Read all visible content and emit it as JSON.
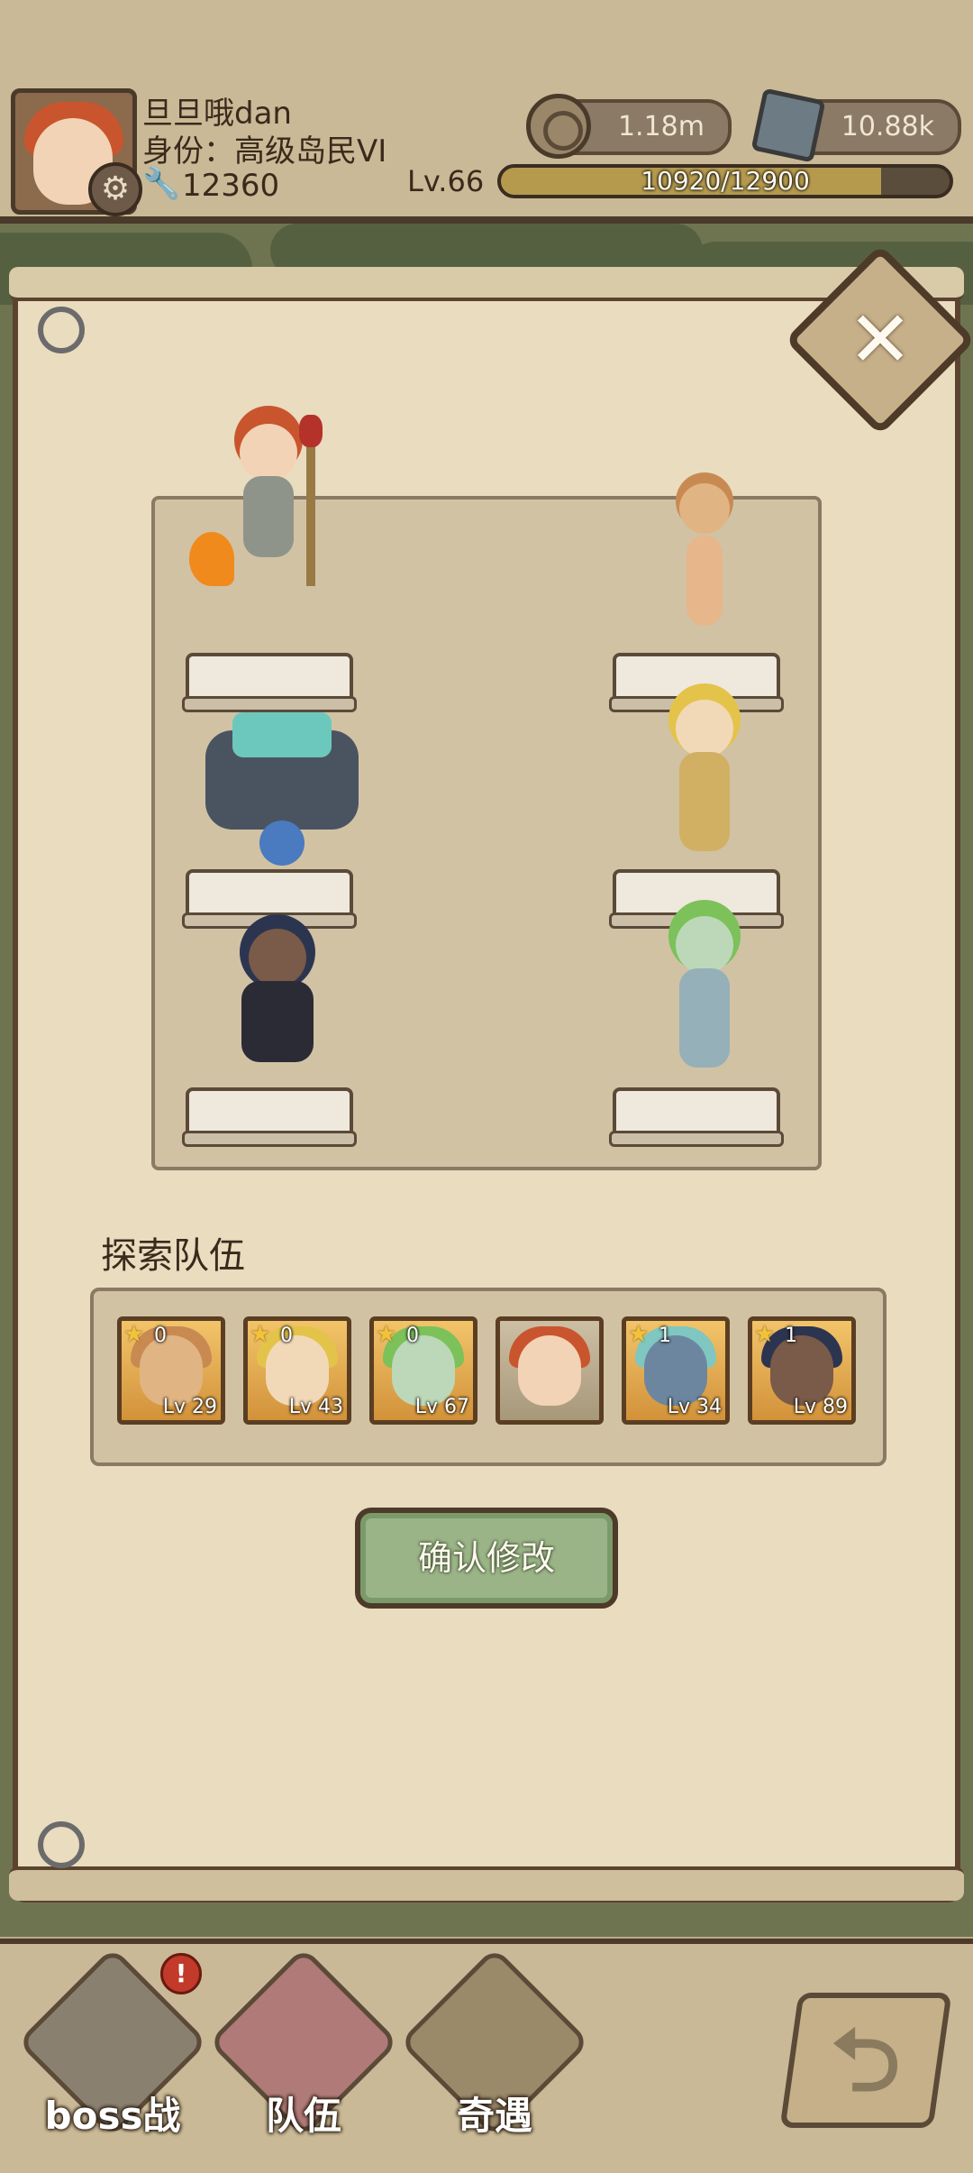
{
  "header": {
    "player_name": "旦旦哦dan",
    "player_identity": "身份：高级岛民VI",
    "player_power": "12360",
    "coins": "1.18m",
    "gems": "10.88k",
    "level_label": "Lv.66",
    "xp_text": "10920/12900",
    "xp_progress": 0.8465
  },
  "modal": {
    "close_icon": "close-icon",
    "formation": {
      "left_column": [
        "fire-staff-mage",
        "crystal-golem",
        "shadow-cloak-girl"
      ],
      "right_column": [
        "tailed-imp-girl",
        "yellow-hair-fighter",
        "green-hair-stone-golem-girl"
      ]
    },
    "team_title": "探索队伍",
    "team": [
      {
        "name": "tailed-imp-girl",
        "stars": "0",
        "level": "Lv 29",
        "color": "#e0b583",
        "hair": "#c98a52",
        "star_icon": true
      },
      {
        "name": "yellow-hair-fighter",
        "stars": "0",
        "level": "Lv 43",
        "color": "#f1d9b8",
        "hair": "#e4c34a",
        "star_icon": true
      },
      {
        "name": "green-hair-golem-girl",
        "stars": "0",
        "level": "Lv 67",
        "color": "#bcd8b8",
        "hair": "#7cc15a",
        "star_icon": true
      },
      {
        "name": "fire-staff-mage",
        "stars": "",
        "level": "",
        "color": "#f2d3b5",
        "hair": "#c9552e",
        "star_icon": false
      },
      {
        "name": "crystal-golem",
        "stars": "1",
        "level": "Lv 34",
        "color": "#6d86a0",
        "hair": "#7fc7c0",
        "star_icon": true
      },
      {
        "name": "shadow-cloak-girl",
        "stars": "1",
        "level": "Lv 89",
        "color": "#7a5a48",
        "hair": "#2c3550",
        "star_icon": true
      }
    ],
    "confirm_label": "确认修改"
  },
  "bottom_nav": {
    "items": [
      {
        "label": "boss战",
        "icon": "skull-helmet-icon"
      },
      {
        "label": "队伍",
        "icon": "red-banner-icon"
      },
      {
        "label": "奇遇",
        "icon": "treasure-sack-icon"
      }
    ],
    "badge": "!",
    "back_icon": "back-arrow-icon"
  }
}
